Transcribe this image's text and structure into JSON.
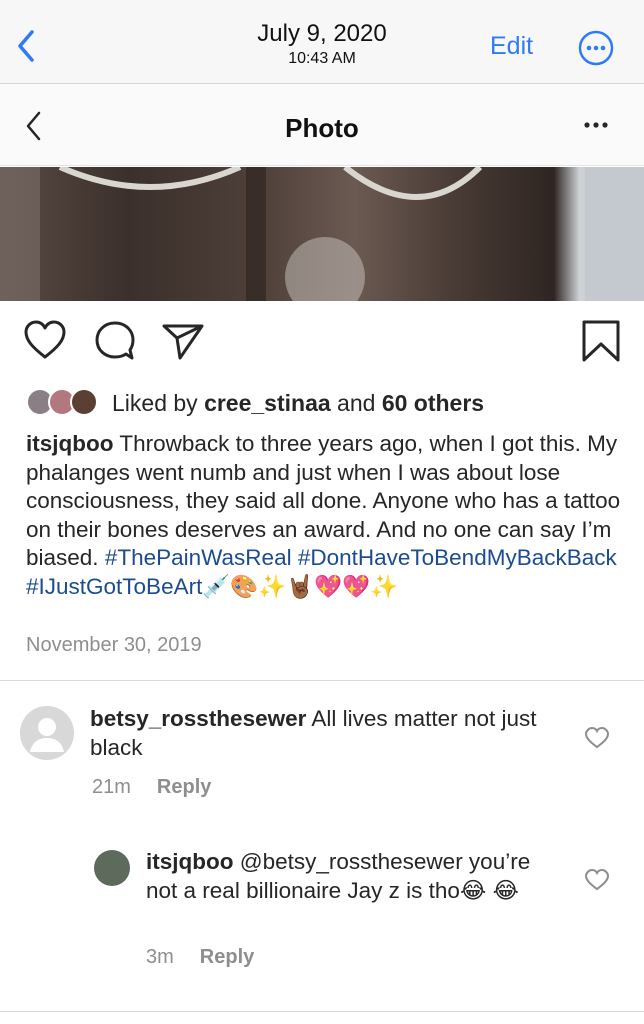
{
  "photos_app": {
    "date": "July 9, 2020",
    "time": "10:43 AM",
    "edit_label": "Edit",
    "accent_color": "#2f7bf5",
    "icons": [
      "back-chevron-icon",
      "more-circle-icon"
    ]
  },
  "instagram": {
    "header": {
      "title": "Photo",
      "icons": [
        "back-chevron-icon",
        "more-dots-icon"
      ]
    },
    "actions": {
      "icons": [
        "heart-icon",
        "comment-icon",
        "share-icon",
        "bookmark-icon"
      ]
    },
    "likes": {
      "prefix": "Liked by",
      "user": "cree_stinaa",
      "middle": "and",
      "others": "60 others"
    },
    "caption": {
      "username": "itsjqboo",
      "text": "Throwback to three years ago, when I got this. My phalanges went numb and just when I was about lose consciousness, they said all done. Anyone who has a tattoo on their bones deserves an award. And no one can say I’m biased.",
      "hashtags": "#ThePainWasReal #DontHaveToBendMyBackBack #IJustGotToBeArt",
      "emojis": "💉🎨✨🤘🏾💖💖✨"
    },
    "post_date": "November 30, 2019",
    "comments": [
      {
        "username": "betsy_rossthesewer",
        "text": "All lives matter not just black",
        "age": "21m",
        "reply_label": "Reply"
      },
      {
        "username": "itsjqboo",
        "text": "@betsy_rossthesewer you’re not a real billionaire Jay z is tho😂 😂",
        "age": "3m",
        "reply_label": "Reply"
      }
    ]
  }
}
